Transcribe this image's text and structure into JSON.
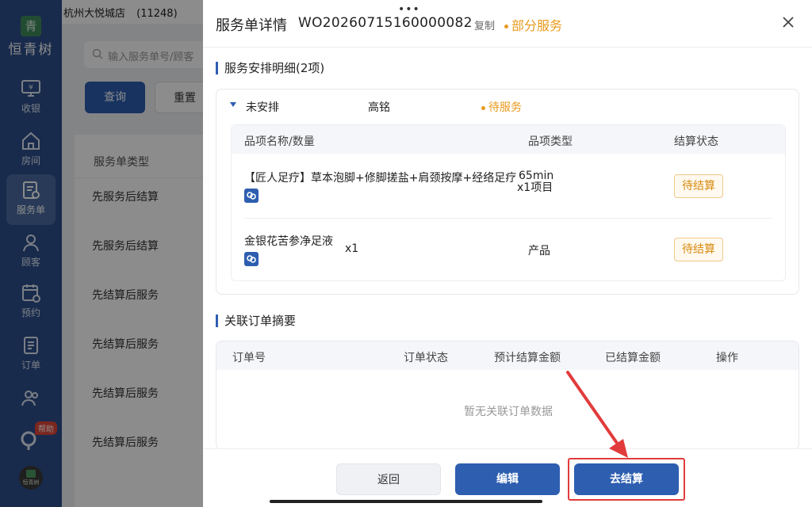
{
  "sidebar": {
    "logo_mark": "青",
    "logo_text": "恒青树",
    "items": [
      {
        "label": "收银",
        "icon": "cashier-icon"
      },
      {
        "label": "房间",
        "icon": "room-icon"
      },
      {
        "label": "服务单",
        "icon": "service-order-icon"
      },
      {
        "label": "顾客",
        "icon": "customer-icon"
      },
      {
        "label": "预约",
        "icon": "appointment-icon"
      },
      {
        "label": "订单",
        "icon": "order-icon"
      },
      {
        "label": "",
        "icon": "staff-icon"
      }
    ],
    "help_badge": "帮助",
    "mini_logo_text": "恒青树"
  },
  "background": {
    "store_name": "杭州大悦城店",
    "store_id": "(11248)",
    "search_placeholder": "输入服务单号/顾客",
    "query_button": "查询",
    "reset_button": "重置",
    "table_header": "服务单类型",
    "rows": [
      "先服务后结算",
      "先服务后结算",
      "先结算后服务",
      "先结算后服务",
      "先结算后服务",
      "先结算后服务"
    ]
  },
  "drawer": {
    "title": "服务单详情",
    "order_no": "WO20260715160000082",
    "copy_label": "复制",
    "status": "部分服务",
    "colors": {
      "accent": "#2d5eb0",
      "warning": "#e89a1d",
      "highlight": "#e13b3b"
    },
    "arrangement": {
      "section_title": "服务安排明细",
      "count": "(2项)",
      "group_label": "未安排",
      "staff": "高铭",
      "group_status": "待服务",
      "headers": {
        "name": "品项名称/数量",
        "type": "品项类型",
        "settle": "结算状态"
      },
      "items": [
        {
          "name": "【匠人足疗】草本泡脚+修脚搓盐+肩颈按摩+经络足疗",
          "qty": "65min",
          "type": "x1项目",
          "settle_status": "待结算"
        },
        {
          "name": "金银花苦参净足液",
          "qty": "x1",
          "type": "产品",
          "settle_status": "待结算"
        }
      ]
    },
    "orders": {
      "section_title": "关联订单摘要",
      "headers": {
        "order_no": "订单号",
        "status": "订单状态",
        "estimated": "预计结算金额",
        "settled": "已结算金额",
        "action": "操作"
      },
      "empty_text": "暂无关联订单数据"
    },
    "footer": {
      "back": "返回",
      "edit": "编辑",
      "settle": "去结算"
    }
  }
}
